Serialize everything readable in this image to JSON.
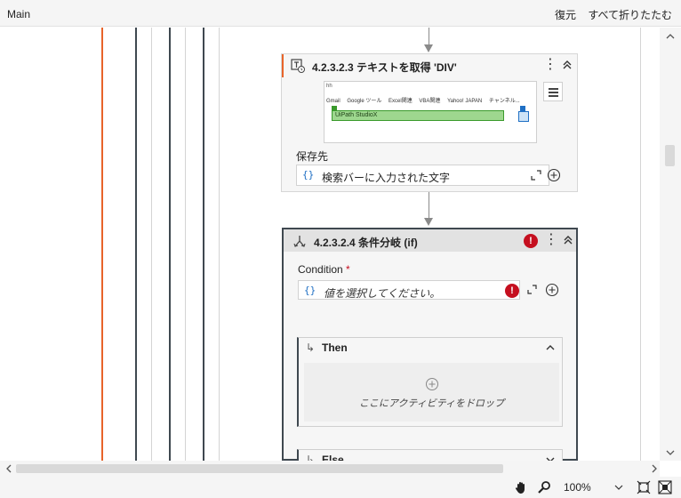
{
  "header": {
    "title": "Main",
    "restore_label": "復元",
    "collapse_all_label": "すべて折りたたむ"
  },
  "get_text_activity": {
    "title": "4.2.3.2.3 テキストを取得 'DIV'",
    "icon": "get-text-icon",
    "screenshot": {
      "top_text": "hh",
      "bookmarks": [
        "Gmail",
        "Google ツール",
        "Excel関連",
        "VBA関連",
        "Yahoo! JAPAN",
        "チャンネル..."
      ],
      "highlight_text": "UiPath StudioX"
    },
    "save_to_label": "保存先",
    "save_to_value": "検索バーに入力された文字"
  },
  "if_activity": {
    "title": "4.2.3.2.4 条件分岐 (if)",
    "icon": "if-branch-icon",
    "error_mark": "!",
    "condition_label": "Condition",
    "required_mark": "*",
    "condition_placeholder": "値を選択してください。",
    "then_label": "Then",
    "drop_hint": "ここにアクティビティをドロップ",
    "else_label": "Else"
  },
  "footer": {
    "zoom_value": "100%"
  },
  "colors": {
    "accent": "#e8642a",
    "error": "#c50f1f",
    "selection_border": "#3f4850",
    "variable_blue": "#1f6fc4"
  }
}
